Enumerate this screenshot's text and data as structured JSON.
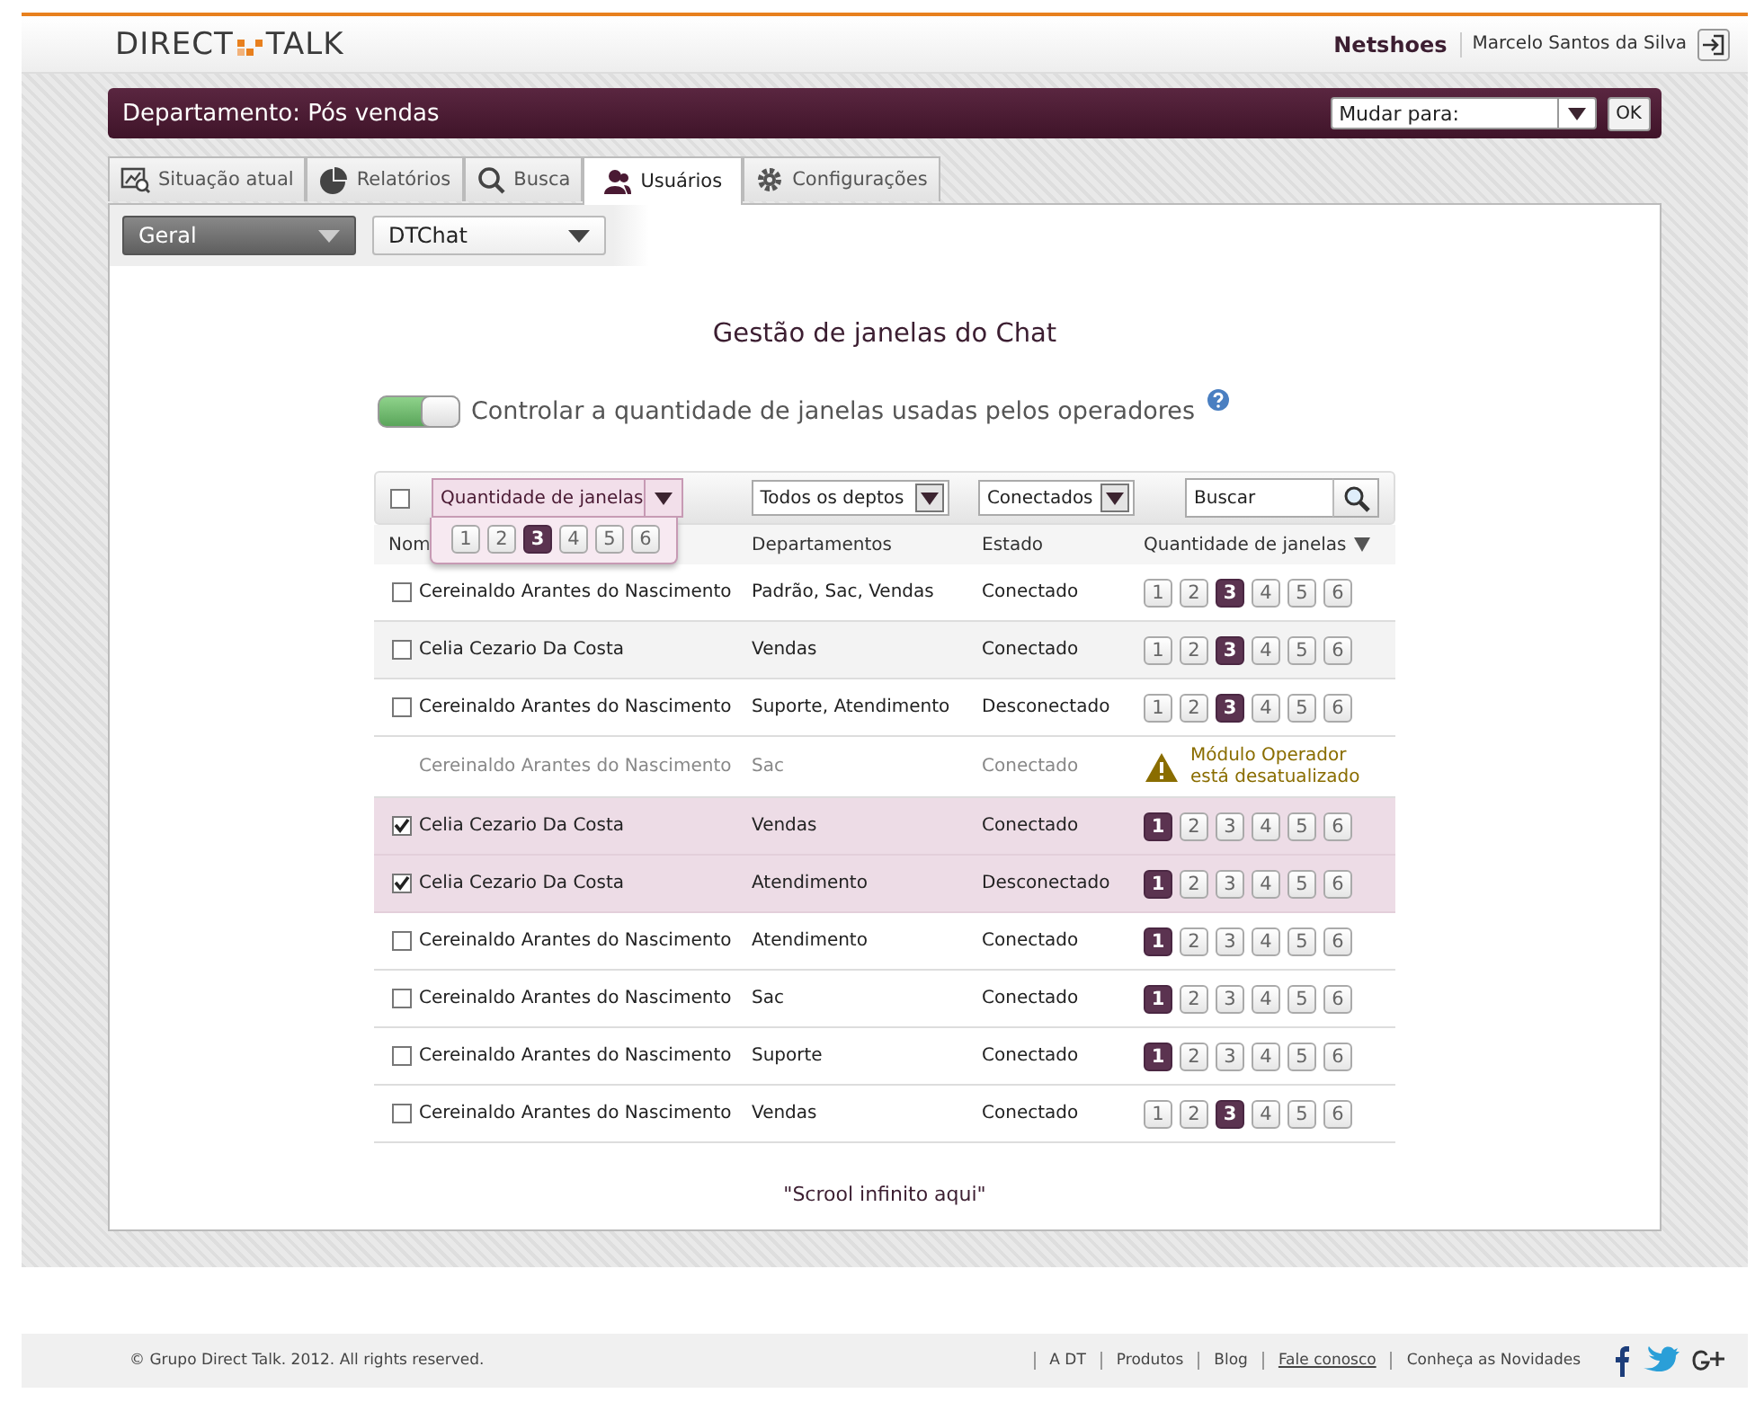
{
  "header": {
    "logo_left": "DIRECT",
    "logo_right": "TALK",
    "company": "Netshoes",
    "user": "Marcelo Santos da Silva"
  },
  "department_bar": {
    "title": "Departamento: Pós vendas",
    "switch_select": "Mudar para:",
    "ok_button": "OK"
  },
  "tabs": [
    {
      "label": "Situação atual",
      "selected": false
    },
    {
      "label": "Relatórios",
      "selected": false
    },
    {
      "label": "Busca",
      "selected": false
    },
    {
      "label": "Usuários",
      "selected": true
    },
    {
      "label": "Configurações",
      "selected": false
    }
  ],
  "filters": [
    {
      "label": "Geral",
      "kind": "dark"
    },
    {
      "label": "DTChat",
      "kind": "light"
    }
  ],
  "title": "Gestão de janelas do Chat",
  "control_toggle": {
    "on": true,
    "label": "Controlar a quantidade de janelas usadas pelos operadores"
  },
  "toolbar": {
    "select_all_checked": false,
    "quantity_filter": {
      "label": "Quantidade de janelas",
      "expanded": true,
      "options": [
        {
          "label": "1",
          "selected": false
        },
        {
          "label": "2",
          "selected": false
        },
        {
          "label": "3",
          "selected": true
        },
        {
          "label": "4",
          "selected": false
        },
        {
          "label": "5",
          "selected": false
        },
        {
          "label": "6",
          "selected": false
        }
      ]
    },
    "department_filter": "Todos os deptos",
    "status_filter": "Conectados",
    "search": {
      "placeholder": "Buscar"
    }
  },
  "table": {
    "columns": [
      "Nom",
      "Departamentos",
      "Estado",
      "Quantidade de janelas"
    ],
    "rows": [
      {
        "kind": "operator",
        "checked": false,
        "hovered": false,
        "name": "Cereinaldo Arantes do Nascimento",
        "departments": "Padrão, Sac, Vendas",
        "status": "Conectado",
        "windows": [
          {
            "label": "1",
            "selected": false
          },
          {
            "label": "2",
            "selected": false
          },
          {
            "label": "3",
            "selected": true
          },
          {
            "label": "4",
            "selected": false
          },
          {
            "label": "5",
            "selected": false
          },
          {
            "label": "6",
            "selected": false
          }
        ]
      },
      {
        "kind": "operator",
        "checked": false,
        "hovered": true,
        "name": "Celia Cezario Da Costa",
        "departments": "Vendas",
        "status": "Conectado",
        "windows": [
          {
            "label": "1",
            "selected": false
          },
          {
            "label": "2",
            "selected": false
          },
          {
            "label": "3",
            "selected": true
          },
          {
            "label": "4",
            "selected": false
          },
          {
            "label": "5",
            "selected": false
          },
          {
            "label": "6",
            "selected": false
          }
        ]
      },
      {
        "kind": "operator",
        "checked": false,
        "hovered": false,
        "name": "Cereinaldo Arantes do Nascimento",
        "departments": "Suporte, Atendimento",
        "status": "Desconectado",
        "windows": [
          {
            "label": "1",
            "selected": false
          },
          {
            "label": "2",
            "selected": false
          },
          {
            "label": "3",
            "selected": true
          },
          {
            "label": "4",
            "selected": false
          },
          {
            "label": "5",
            "selected": false
          },
          {
            "label": "6",
            "selected": false
          }
        ]
      },
      {
        "kind": "outdated",
        "name": "Cereinaldo Arantes do Nascimento",
        "departments": "Sac",
        "status": "Conectado",
        "warning": "Módulo Operador está desatualizado"
      },
      {
        "kind": "operator",
        "checked": true,
        "hovered": false,
        "name": "Celia Cezario Da Costa",
        "departments": "Vendas",
        "status": "Conectado",
        "windows": [
          {
            "label": "1",
            "selected": true
          },
          {
            "label": "2",
            "selected": false
          },
          {
            "label": "3",
            "selected": false
          },
          {
            "label": "4",
            "selected": false
          },
          {
            "label": "5",
            "selected": false
          },
          {
            "label": "6",
            "selected": false
          }
        ]
      },
      {
        "kind": "operator",
        "checked": true,
        "hovered": false,
        "name": "Celia Cezario Da Costa",
        "departments": "Atendimento",
        "status": "Desconectado",
        "windows": [
          {
            "label": "1",
            "selected": true
          },
          {
            "label": "2",
            "selected": false
          },
          {
            "label": "3",
            "selected": false
          },
          {
            "label": "4",
            "selected": false
          },
          {
            "label": "5",
            "selected": false
          },
          {
            "label": "6",
            "selected": false
          }
        ]
      },
      {
        "kind": "operator",
        "checked": false,
        "hovered": false,
        "name": "Cereinaldo Arantes do Nascimento",
        "departments": "Atendimento",
        "status": "Conectado",
        "windows": [
          {
            "label": "1",
            "selected": true
          },
          {
            "label": "2",
            "selected": false
          },
          {
            "label": "3",
            "selected": false
          },
          {
            "label": "4",
            "selected": false
          },
          {
            "label": "5",
            "selected": false
          },
          {
            "label": "6",
            "selected": false
          }
        ]
      },
      {
        "kind": "operator",
        "checked": false,
        "hovered": false,
        "name": "Cereinaldo Arantes do Nascimento",
        "departments": "Sac",
        "status": "Conectado",
        "windows": [
          {
            "label": "1",
            "selected": true
          },
          {
            "label": "2",
            "selected": false
          },
          {
            "label": "3",
            "selected": false
          },
          {
            "label": "4",
            "selected": false
          },
          {
            "label": "5",
            "selected": false
          },
          {
            "label": "6",
            "selected": false
          }
        ]
      },
      {
        "kind": "operator",
        "checked": false,
        "hovered": false,
        "name": "Cereinaldo Arantes do Nascimento",
        "departments": "Suporte",
        "status": "Conectado",
        "windows": [
          {
            "label": "1",
            "selected": true
          },
          {
            "label": "2",
            "selected": false
          },
          {
            "label": "3",
            "selected": false
          },
          {
            "label": "4",
            "selected": false
          },
          {
            "label": "5",
            "selected": false
          },
          {
            "label": "6",
            "selected": false
          }
        ]
      },
      {
        "kind": "operator",
        "checked": false,
        "hovered": false,
        "name": "Cereinaldo Arantes do Nascimento",
        "departments": "Vendas",
        "status": "Conectado",
        "windows": [
          {
            "label": "1",
            "selected": false
          },
          {
            "label": "2",
            "selected": false
          },
          {
            "label": "3",
            "selected": true
          },
          {
            "label": "4",
            "selected": false
          },
          {
            "label": "5",
            "selected": false
          },
          {
            "label": "6",
            "selected": false
          }
        ]
      }
    ]
  },
  "note": "\"Scrool infinito aqui\"",
  "footer": {
    "copyright": "© Grupo Direct Talk. 2012. All rights reserved.",
    "links": [
      {
        "label": "A DT",
        "underlined": false
      },
      {
        "label": "Produtos",
        "underlined": false
      },
      {
        "label": "Blog",
        "underlined": false
      },
      {
        "label": "Fale conosco",
        "underlined": true
      },
      {
        "label": "Conheça as Novidades",
        "underlined": false
      }
    ]
  }
}
